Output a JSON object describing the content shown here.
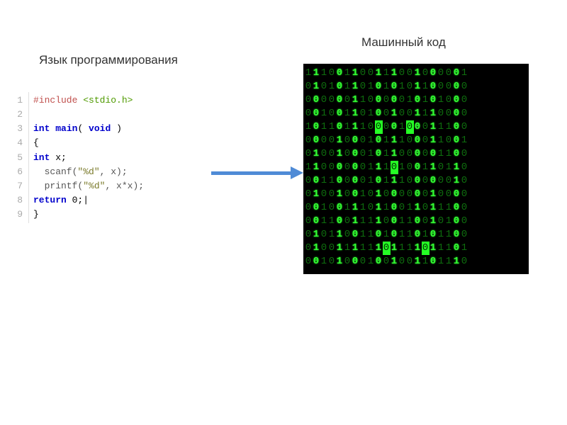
{
  "labels": {
    "left": "Язык программирования",
    "right": "Машинный код"
  },
  "code": {
    "lines": [
      {
        "n": "1",
        "segments": [
          {
            "t": "#include ",
            "c": "pp"
          },
          {
            "t": "<stdio.h>",
            "c": "inc"
          }
        ]
      },
      {
        "n": "2",
        "segments": [
          {
            "t": "",
            "c": ""
          }
        ]
      },
      {
        "n": "3",
        "segments": [
          {
            "t": "int ",
            "c": "kw"
          },
          {
            "t": "main",
            "c": "kw"
          },
          {
            "t": "( ",
            "c": ""
          },
          {
            "t": "void",
            "c": "kw"
          },
          {
            "t": " )",
            "c": ""
          }
        ]
      },
      {
        "n": "4",
        "segments": [
          {
            "t": "{",
            "c": ""
          }
        ]
      },
      {
        "n": "5",
        "segments": [
          {
            "t": "int ",
            "c": "kw"
          },
          {
            "t": "x;",
            "c": ""
          }
        ]
      },
      {
        "n": "6",
        "segments": [
          {
            "t": "  scanf(",
            "c": "fn"
          },
          {
            "t": "\"%d\"",
            "c": "str"
          },
          {
            "t": ", x);",
            "c": "fn"
          }
        ]
      },
      {
        "n": "7",
        "segments": [
          {
            "t": "  printf(",
            "c": "fn"
          },
          {
            "t": "\"%d\"",
            "c": "str"
          },
          {
            "t": ", x*x);",
            "c": "fn"
          }
        ]
      },
      {
        "n": "8",
        "segments": [
          {
            "t": "return ",
            "c": "kw"
          },
          {
            "t": "0;|",
            "c": ""
          }
        ]
      },
      {
        "n": "9",
        "segments": [
          {
            "t": "}",
            "c": ""
          }
        ]
      }
    ]
  },
  "binary": {
    "rows": [
      "111001100111001000001",
      "010101101010101100000",
      "000000110000010101000",
      "001001101001001110000",
      "101101110X001X0011100",
      "000010001011100011001",
      "010010001011000001100",
      "11000000111X100110110",
      "001100001011100000010",
      "010010010100000010000",
      "001001110110011011100",
      "001100111100110010100",
      "010110011010110101100",
      "0100111111X1111X11101",
      "001010001001001101110"
    ]
  }
}
